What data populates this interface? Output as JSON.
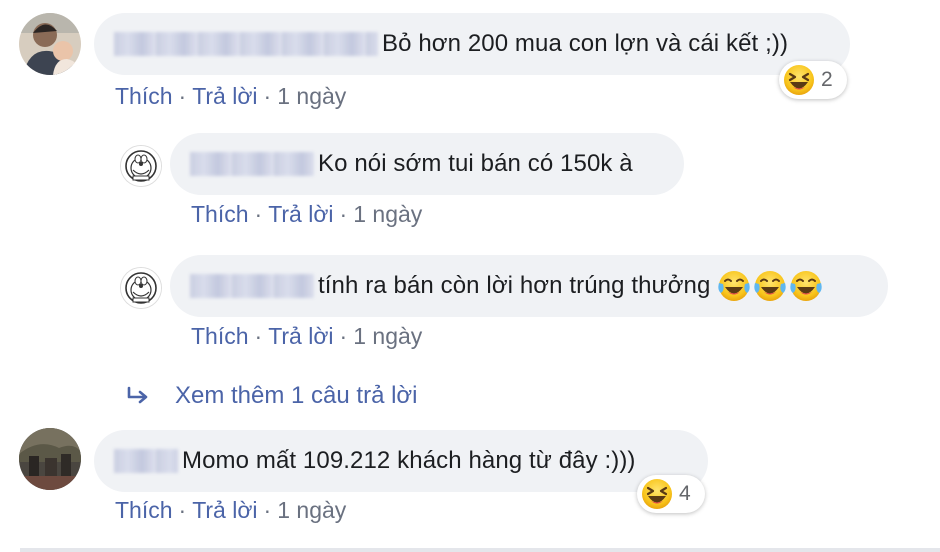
{
  "comments": [
    {
      "text": "Bỏ hơn 200 mua con lợn và cái kết ;))",
      "actions": {
        "like": "Thích",
        "reply": "Trả lời",
        "time": "1 ngày"
      },
      "reaction_count": "2",
      "reaction_icon": "laughing-squint-emoji"
    },
    {
      "text": "Momo mất 109.212 khách hàng từ đây :)))",
      "actions": {
        "like": "Thích",
        "reply": "Trả lời",
        "time": "1 ngày"
      },
      "reaction_count": "4",
      "reaction_icon": "laughing-squint-emoji"
    }
  ],
  "replies": [
    {
      "text": "Ko nói sớm tui bán có 150k à",
      "actions": {
        "like": "Thích",
        "reply": "Trả lời",
        "time": "1 ngày"
      },
      "avatar_icon": "doraemon-avatar"
    },
    {
      "text": "tính ra bán còn lời hơn trúng thưởng",
      "actions": {
        "like": "Thích",
        "reply": "Trả lời",
        "time": "1 ngày"
      },
      "avatar_icon": "doraemon-avatar",
      "trailing_emojis": [
        "tears-of-joy-emoji",
        "tears-of-joy-emoji",
        "tears-of-joy-emoji"
      ]
    }
  ],
  "more_replies": {
    "label": "Xem thêm 1 câu trả lời",
    "icon": "reply-arrow-icon"
  },
  "colors": {
    "link": "#4b64a8",
    "bubble": "#f0f2f5",
    "meta": "#6a7180"
  },
  "separator": "·"
}
